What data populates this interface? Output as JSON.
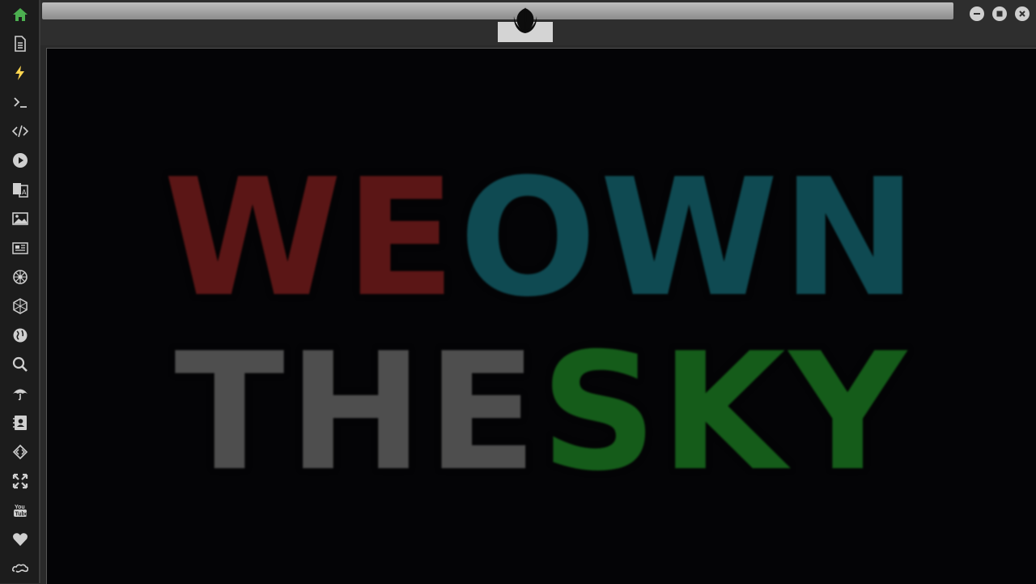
{
  "window": {
    "minimize_label": "minimize",
    "maximize_label": "maximize",
    "close_label": "close"
  },
  "sidebar": {
    "items": [
      {
        "name": "home-icon",
        "color": "#4caf50"
      },
      {
        "name": "document-icon",
        "color": "#cfcfcf"
      },
      {
        "name": "lightning-icon",
        "color": "#ffd54f"
      },
      {
        "name": "terminal-icon",
        "color": "#cfcfcf"
      },
      {
        "name": "code-icon",
        "color": "#cfcfcf"
      },
      {
        "name": "play-icon",
        "color": "#cfcfcf"
      },
      {
        "name": "translate-icon",
        "color": "#cfcfcf"
      },
      {
        "name": "image-icon",
        "color": "#cfcfcf"
      },
      {
        "name": "newspaper-icon",
        "color": "#cfcfcf"
      },
      {
        "name": "empire-icon",
        "color": "#cfcfcf"
      },
      {
        "name": "hexagon-network-icon",
        "color": "#cfcfcf"
      },
      {
        "name": "globe-icon",
        "color": "#cfcfcf"
      },
      {
        "name": "search-icon",
        "color": "#cfcfcf"
      },
      {
        "name": "umbrella-icon",
        "color": "#cfcfcf"
      },
      {
        "name": "contact-book-icon",
        "color": "#cfcfcf"
      },
      {
        "name": "diamond-code-icon",
        "color": "#cfcfcf"
      },
      {
        "name": "expand-icon",
        "color": "#cfcfcf"
      },
      {
        "name": "youtube-icon",
        "color": "#cfcfcf"
      },
      {
        "name": "heart-icon",
        "color": "#cfcfcf"
      },
      {
        "name": "infinity-cloud-icon",
        "color": "#cfcfcf"
      }
    ]
  },
  "topbar": {
    "logo_name": "rebel-alliance-icon"
  },
  "content": {
    "line1": {
      "a": "WE",
      "b": "OWN"
    },
    "line2": {
      "a": "THE",
      "b": "SKY"
    },
    "colors": {
      "red": "#5b1616",
      "teal": "#0f4a52",
      "grey": "#4e4e4e",
      "green": "#155c1a"
    }
  }
}
